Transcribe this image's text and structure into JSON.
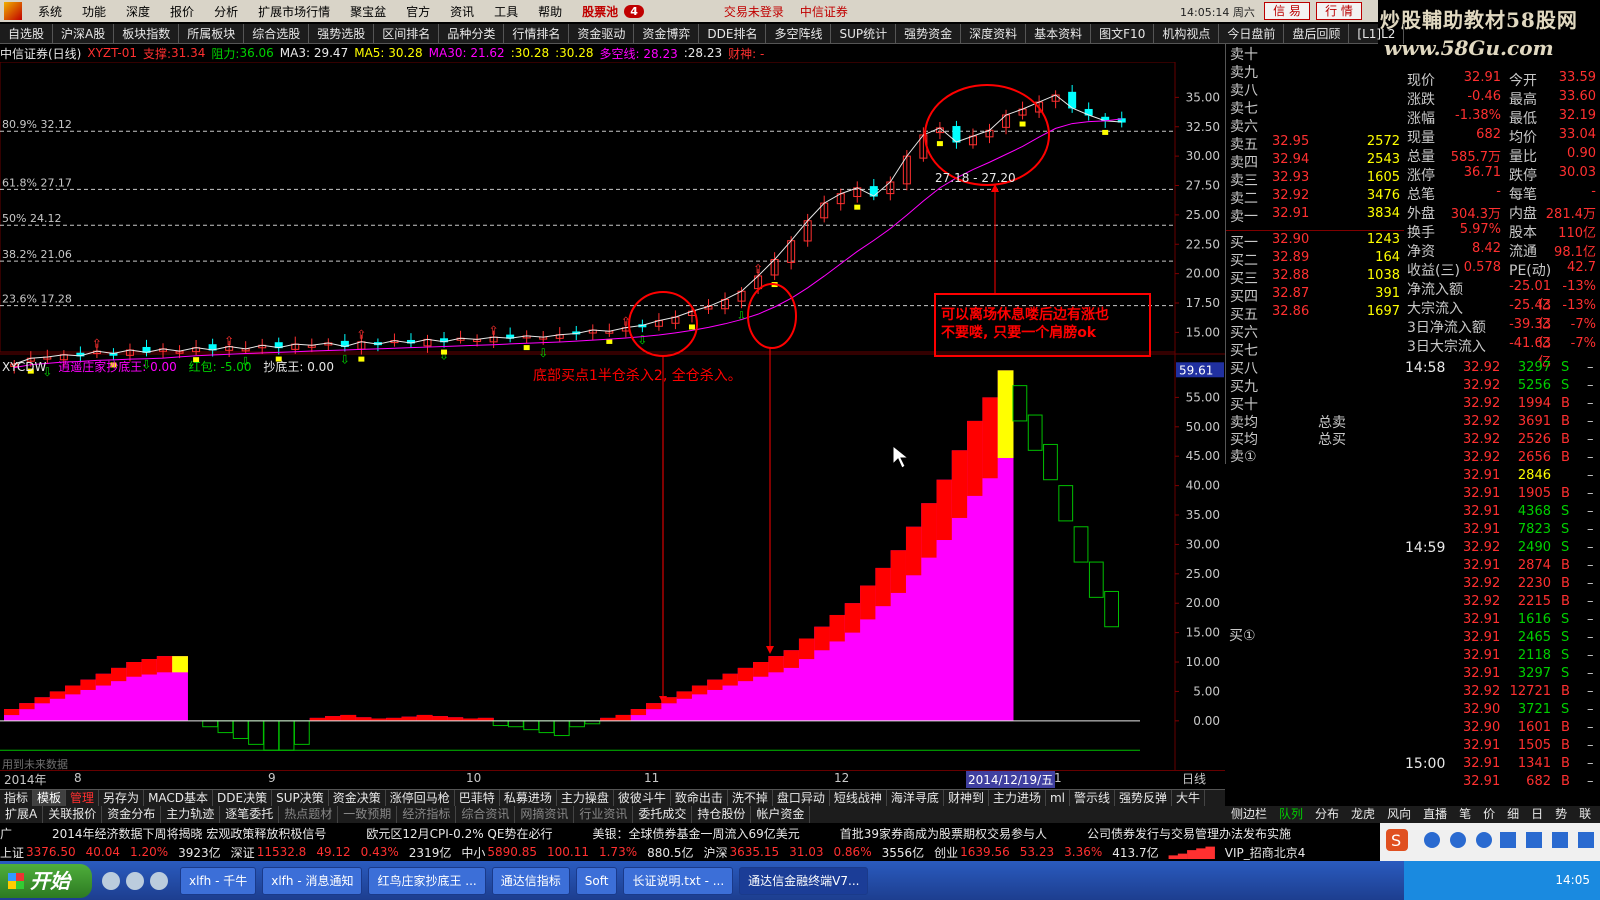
{
  "menubar": {
    "items": [
      "系统",
      "功能",
      "深度",
      "报价",
      "分析",
      "扩展市场行情",
      "聚宝盆",
      "官方",
      "资讯",
      "工具",
      "帮助"
    ],
    "stock_pool": "股票池",
    "stock_pool_count": "4",
    "login_status": "交易未登录",
    "broker": "中信证券",
    "clock": "14:05:14 周六",
    "btn_trade": "信 易",
    "btn_quote": "行 情"
  },
  "brand": {
    "line1": "炒股輔助教材58股网",
    "line2": "www.58Gu.com"
  },
  "tabbar": {
    "tabs": [
      "自选股",
      "沪深A股",
      "板块指数",
      "所属板块",
      "综合选股",
      "强势选股",
      "区间排名",
      "品种分类",
      "行情排名",
      "资金驱动",
      "资金博弈",
      "DDE排名",
      "多空阵线",
      "SUP统计",
      "强势资金",
      "深度资料",
      "基本资料",
      "图文F10",
      "机构视点",
      "今日盘前",
      "盘后回顾",
      "[L1]L2"
    ]
  },
  "info": {
    "title": "中信证券(日线)",
    "formula": "XYZT-01",
    "support_label": "支撑:",
    "support": "31.34",
    "resist_label": "阻力:",
    "resist": "36.06",
    "ma3": "MA3: 29.47",
    "ma5": "MA5: 30.28",
    "ma30": "MA30: 21.62",
    "v1": ":30.28",
    "v2": ":30.28",
    "longshort": "多空线: 28.23",
    "v3": ":28.23",
    "caishen": "财神: -"
  },
  "fib": [
    {
      "label": "80.9% 32.12"
    },
    {
      "label": "61.8% 27.17"
    },
    {
      "label": "50% 24.12"
    },
    {
      "label": "38.2% 21.06"
    },
    {
      "label": "23.6% 17.28"
    }
  ],
  "price_axis": [
    "35.00",
    "32.50",
    "30.00",
    "27.50",
    "25.00",
    "22.50",
    "20.00",
    "17.50",
    "15.00"
  ],
  "ind_axis": [
    "55.00",
    "50.00",
    "45.00",
    "40.00",
    "35.00",
    "30.00",
    "25.00",
    "20.00",
    "15.00",
    "10.00",
    "5.00",
    "0.00"
  ],
  "ind_marker": "59.61",
  "indicator": {
    "name": "XYCDW",
    "line1": "逍遥庄家抄底王: 0.00",
    "line2": "红包: -5.00",
    "line3": "抄底王: 0.00"
  },
  "annotations": {
    "bottom_buy": "底部买点1半仓杀入2, 全仓杀入。",
    "top_note_1": "可以离场休息喽后边有涨也",
    "top_note_2": "不要喽, 只要一个肩膀ok",
    "cross_label": "27.18 - 27.20"
  },
  "footnote": "用到未来数据",
  "date_axis": {
    "year": "2014年",
    "m8": "8",
    "m9": "9",
    "m10": "10",
    "m11": "11",
    "m12": "12",
    "selected": "2014/12/19/五",
    "m1": "1"
  },
  "timeframe": "日线",
  "order_book": {
    "asks": [
      {
        "label": "卖十",
        "price": "",
        "vol": ""
      },
      {
        "label": "卖九",
        "price": "",
        "vol": ""
      },
      {
        "label": "卖八",
        "price": "",
        "vol": ""
      },
      {
        "label": "卖七",
        "price": "",
        "vol": ""
      },
      {
        "label": "卖六",
        "price": "",
        "vol": ""
      },
      {
        "label": "卖五",
        "price": "32.95",
        "vol": "2572"
      },
      {
        "label": "卖四",
        "price": "32.94",
        "vol": "2543"
      },
      {
        "label": "卖三",
        "price": "32.93",
        "vol": "1605"
      },
      {
        "label": "卖二",
        "price": "32.92",
        "vol": "3476"
      },
      {
        "label": "卖一",
        "price": "32.91",
        "vol": "3834"
      }
    ],
    "bids": [
      {
        "label": "买一",
        "price": "32.90",
        "vol": "1243"
      },
      {
        "label": "买二",
        "price": "32.89",
        "vol": "164"
      },
      {
        "label": "买三",
        "price": "32.88",
        "vol": "1038"
      },
      {
        "label": "买四",
        "price": "32.87",
        "vol": "391"
      },
      {
        "label": "买五",
        "price": "32.86",
        "vol": "1697"
      },
      {
        "label": "买六",
        "price": "",
        "vol": ""
      },
      {
        "label": "买七",
        "price": "",
        "vol": ""
      },
      {
        "label": "买八",
        "price": "",
        "vol": ""
      },
      {
        "label": "买九",
        "price": "",
        "vol": ""
      },
      {
        "label": "买十",
        "price": "",
        "vol": ""
      }
    ],
    "ask_avg": "卖均",
    "bid_avg": "买均",
    "total_sell": "总卖",
    "total_buy": "总买",
    "sell_1": "卖①",
    "buy_1": "买①"
  },
  "stats": [
    {
      "k": "现价",
      "v": "32.91",
      "k2": "今开",
      "v2": "33.59"
    },
    {
      "k": "涨跌",
      "v": "-0.46",
      "k2": "最高",
      "v2": "33.60"
    },
    {
      "k": "涨幅",
      "v": "-1.38%",
      "k2": "最低",
      "v2": "32.19"
    },
    {
      "k": "现量",
      "v": "682",
      "k2": "均价",
      "v2": "33.04"
    },
    {
      "k": "总量",
      "v": "585.7万",
      "k2": "量比",
      "v2": "0.90"
    },
    {
      "k": "涨停",
      "v": "36.71",
      "k2": "跌停",
      "v2": "30.03"
    },
    {
      "k": "总笔",
      "v": "-",
      "k2": "每笔",
      "v2": "-"
    },
    {
      "k": "外盘",
      "v": "304.3万",
      "k2": "内盘",
      "v2": "281.4万"
    },
    {
      "k": "换手",
      "v": "5.97%",
      "k2": "股本",
      "v2": "110亿"
    },
    {
      "k": "净资",
      "v": "8.42",
      "k2": "流通",
      "v2": "98.1亿"
    },
    {
      "k": "收益(三)",
      "v": "0.578",
      "k2": "PE(动)",
      "v2": "42.7"
    },
    {
      "k": "净流入额",
      "v": "-25.01亿",
      "k2": "",
      "v2": "-13%"
    },
    {
      "k": "大宗流入",
      "v": "-25.43亿",
      "k2": "",
      "v2": "-13%"
    },
    {
      "k": "3日净流入额",
      "v": "-39.33亿",
      "k2": "",
      "v2": "-7%"
    },
    {
      "k": "3日大宗流入",
      "v": "-41.63亿",
      "k2": "",
      "v2": "-7%"
    }
  ],
  "ticks": [
    {
      "t": "14:58",
      "p": "32.92",
      "q": "3297",
      "s": "S"
    },
    {
      "t": "",
      "p": "32.92",
      "q": "5256",
      "s": "S"
    },
    {
      "t": "",
      "p": "32.92",
      "q": "1994",
      "s": "B"
    },
    {
      "t": "",
      "p": "32.92",
      "q": "3691",
      "s": "B"
    },
    {
      "t": "",
      "p": "32.92",
      "q": "2526",
      "s": "B"
    },
    {
      "t": "",
      "p": "32.92",
      "q": "2656",
      "s": "B"
    },
    {
      "t": "",
      "p": "32.91",
      "q": "2846",
      "s": ""
    },
    {
      "t": "",
      "p": "32.91",
      "q": "1905",
      "s": "B"
    },
    {
      "t": "",
      "p": "32.91",
      "q": "4368",
      "s": "S"
    },
    {
      "t": "",
      "p": "32.91",
      "q": "7823",
      "s": "S"
    },
    {
      "t": "14:59",
      "p": "32.92",
      "q": "2490",
      "s": "S"
    },
    {
      "t": "",
      "p": "32.91",
      "q": "2874",
      "s": "B"
    },
    {
      "t": "",
      "p": "32.92",
      "q": "2230",
      "s": "B"
    },
    {
      "t": "",
      "p": "32.92",
      "q": "2215",
      "s": "B"
    },
    {
      "t": "",
      "p": "32.91",
      "q": "1616",
      "s": "S"
    },
    {
      "t": "",
      "p": "32.91",
      "q": "2465",
      "s": "S"
    },
    {
      "t": "",
      "p": "32.91",
      "q": "2118",
      "s": "S"
    },
    {
      "t": "",
      "p": "32.91",
      "q": "3297",
      "s": "S"
    },
    {
      "t": "",
      "p": "32.92",
      "q": "12721",
      "s": "B"
    },
    {
      "t": "",
      "p": "32.90",
      "q": "3721",
      "s": "S"
    },
    {
      "t": "",
      "p": "32.90",
      "q": "1601",
      "s": "B"
    },
    {
      "t": "",
      "p": "32.91",
      "q": "1505",
      "s": "B"
    },
    {
      "t": "15:00",
      "p": "32.91",
      "q": "1341",
      "s": "B"
    },
    {
      "t": "",
      "p": "32.91",
      "q": "682",
      "s": "B"
    }
  ],
  "tab_row1": [
    "指标",
    "模板",
    "管理",
    "另存为",
    "MACD基本",
    "DDE决策",
    "SUP决策",
    "资金决策",
    "涨停回马枪",
    "巴菲特",
    "私募进场",
    "主力操盘",
    "彼彼斗牛",
    "致命出击",
    "洗不掉",
    "盘口异动",
    "短线战神",
    "海洋寻底",
    "财神到",
    "主力进场",
    "ml",
    "警示线",
    "强势反弹",
    "大牛"
  ],
  "tab_row2": [
    "扩展A",
    "关联报价",
    "资金分布",
    "主力轨迹",
    "逐笔委托",
    "热点题材",
    "一致预期",
    "经济指标",
    "综合资讯",
    "网摘资讯",
    "行业资讯",
    "委托成交",
    "持仓股份",
    "帐户资金"
  ],
  "side_tabs": [
    "侧边栏",
    "队列",
    "分布",
    "龙虎",
    "风向",
    "直播",
    "笔",
    "价",
    "细",
    "日",
    "势",
    "联",
    "值",
    "筹"
  ],
  "news": [
    "广",
    "2014年经济数据下周将揭晓 宏观政策释放积极信号",
    "欧元区12月CPI-0.2% QE势在必行",
    "美银：全球债券基金一周流入69亿美元",
    "首批39家券商成为股票期权交易参与人",
    "公司债券发行与交易管理办法发布实施"
  ],
  "status": {
    "sh_label": "上证",
    "sh": "3376.50",
    "sh_chg": "40.04",
    "sh_pct": "1.20%",
    "sh_amt": "3923亿",
    "sz_label": "深证",
    "sz": "11532.8",
    "sz_chg": "49.12",
    "sz_pct": "0.43%",
    "sz_amt": "2319亿",
    "zx_label": "中小",
    "zx": "5890.85",
    "zx_chg": "100.11",
    "zx_pct": "1.73%",
    "zx_amt": "880.5亿",
    "hs_label": "沪深",
    "hs": "3635.15",
    "hs_chg": "31.03",
    "hs_pct": "0.86%",
    "hs_amt": "3556亿",
    "cy_label": "创业",
    "cy": "1639.56",
    "cy_chg": "53.23",
    "cy_pct": "3.36%",
    "cy_amt": "413.7亿",
    "server": "VIP_招商北京4"
  },
  "taskbar": {
    "start": "开始",
    "tasks": [
      "xlfh - 千牛",
      "xlfh - 消息通知",
      "红鸟庄家抄底王 ...",
      "通达信指标",
      "Soft",
      "长证说明.txt - ...",
      "通达信金融终端V7..."
    ],
    "clock": "14:05"
  },
  "chart_data": {
    "type": "candlestick",
    "price_axis_range": [
      13.5,
      37.5
    ],
    "indicator_axis_range": [
      -7,
      60
    ],
    "price_closes_approx": [
      12.3,
      12.8,
      12.9,
      13.1,
      13.0,
      13.4,
      13.2,
      13.5,
      13.3,
      13.6,
      13.4,
      13.7,
      13.5,
      13.8,
      13.6,
      13.9,
      13.7,
      14.0,
      13.9,
      14.1,
      13.8,
      14.2,
      14.0,
      14.3,
      14.1,
      14.4,
      14.2,
      14.5,
      14.4,
      14.6,
      14.5,
      14.7,
      14.6,
      14.8,
      14.9,
      15.2,
      15.1,
      15.4,
      15.6,
      16.0,
      16.3,
      16.8,
      17.2,
      17.8,
      18.5,
      19.8,
      21.2,
      22.8,
      24.5,
      26.0,
      26.8,
      27.3,
      26.6,
      27.8,
      30.0,
      31.8,
      32.4,
      31.2,
      31.7,
      32.2,
      33.5,
      34.0,
      34.6,
      35.2,
      34.1,
      33.5,
      33.0,
      32.9
    ],
    "indicator_bars_approx": [
      2,
      3,
      4,
      5,
      6,
      7,
      8,
      9,
      10,
      10.5,
      11,
      11,
      0,
      -1,
      -2,
      -3,
      -4,
      -5,
      -5,
      -4,
      0.5,
      0.8,
      1,
      0.6,
      0.4,
      0.5,
      0.7,
      1,
      0.8,
      0.6,
      0.4,
      0.5,
      -0.8,
      -1,
      -1.5,
      -2,
      -2.5,
      -1,
      -0.5,
      0.5,
      1,
      2,
      3,
      4,
      5,
      6,
      7,
      8,
      9,
      10,
      11,
      12,
      14,
      16,
      18,
      20,
      23,
      26,
      29,
      33,
      37,
      41,
      46,
      51,
      55,
      59.6,
      57,
      52,
      47,
      40,
      33,
      27,
      22
    ]
  }
}
